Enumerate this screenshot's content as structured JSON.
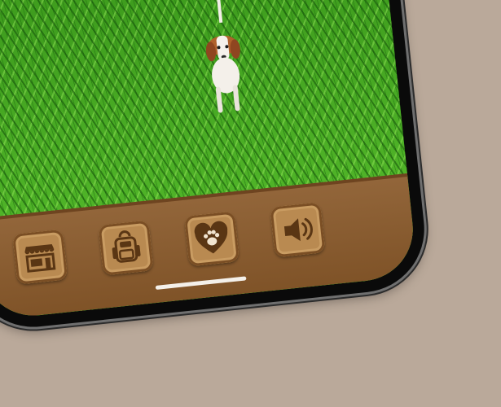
{
  "app": {
    "scene": "pet-game-yard"
  },
  "toolbar": {
    "buttons": [
      {
        "id": "shop",
        "icon": "shop-icon"
      },
      {
        "id": "backpack",
        "icon": "backpack-icon"
      },
      {
        "id": "pet-love",
        "icon": "heart-paw-icon"
      },
      {
        "id": "sound",
        "icon": "speaker-icon"
      }
    ]
  },
  "colors": {
    "background": "#baa99a",
    "grass": "#4fb328",
    "toolbar": "#8a5a2b",
    "button_face": "#b98a51",
    "icon_dark": "#5a3614"
  }
}
